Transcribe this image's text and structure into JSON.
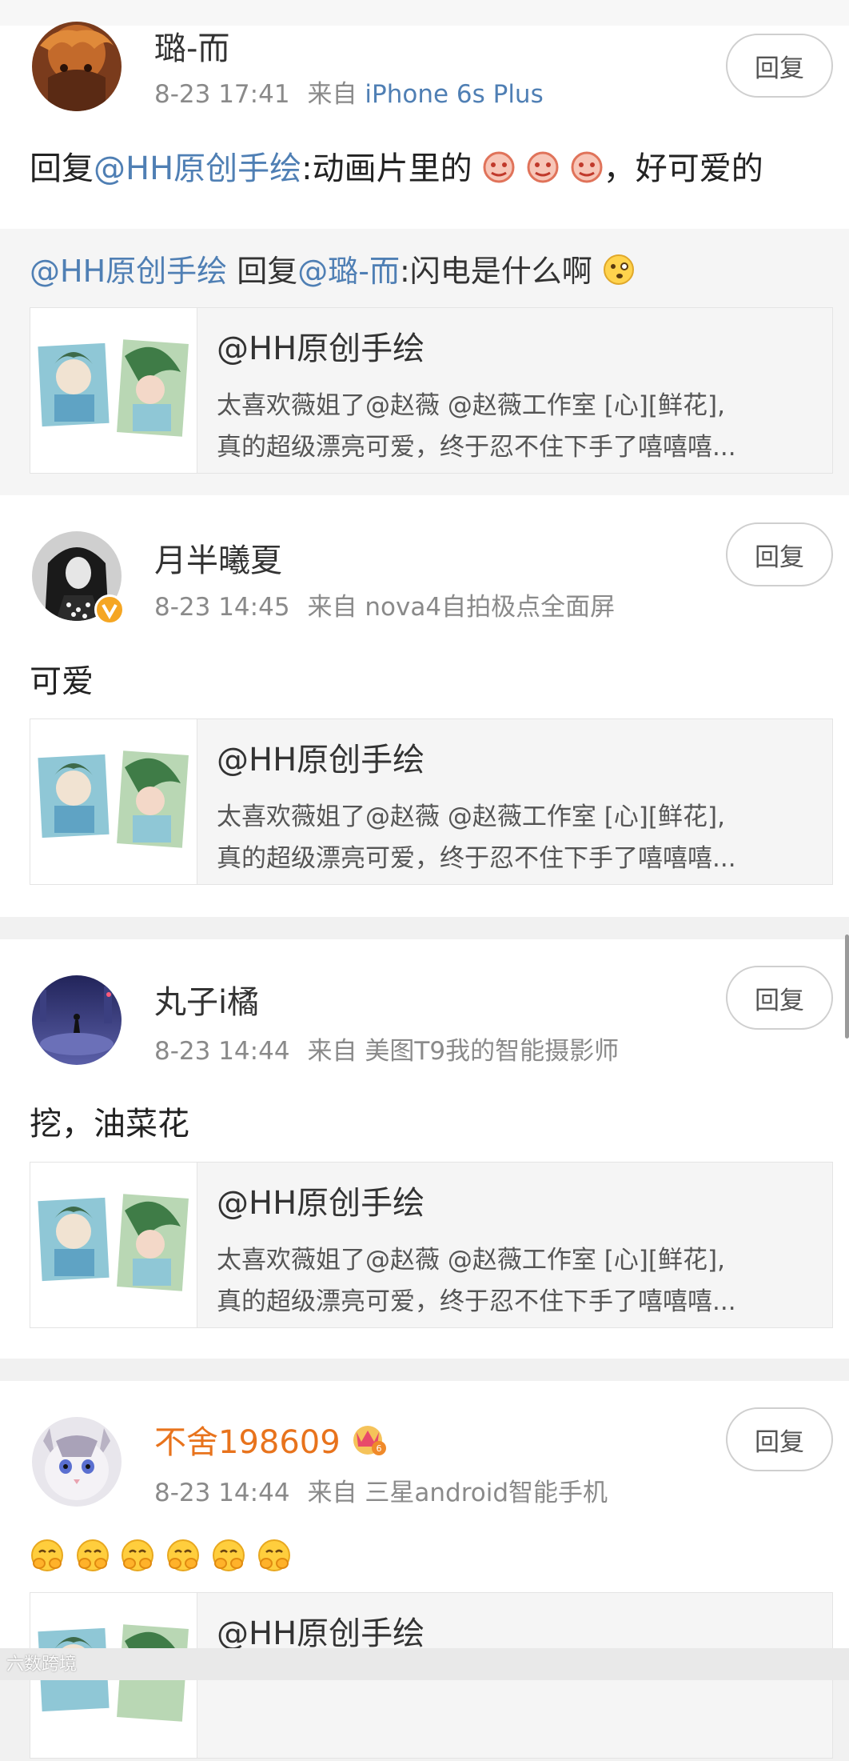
{
  "comments": [
    {
      "username": "璐-而",
      "timestamp": "8-23 17:41",
      "source_prefix": "来自",
      "device": "iPhone 6s Plus",
      "reply_label": "回复",
      "content": {
        "prefix": "回复",
        "mention": "@HH原创手绘",
        "text": ":动画片里的",
        "suffix": "，好可爱的"
      },
      "sub_reply": {
        "author": "@HH原创手绘",
        "reply_word": "回复",
        "target": "@璐-而",
        "text": ":闪电是什么啊"
      },
      "quote": {
        "title": "@HH原创手绘",
        "line1": "太喜欢薇姐了@赵薇 @赵薇工作室 [心][鲜花],",
        "line2": "真的超级漂亮可爱，终于忍不住下手了嘻嘻嘻..."
      }
    },
    {
      "username": "月半曦夏",
      "timestamp": "8-23 14:45",
      "source_prefix": "来自",
      "device": "nova4自拍极点全面屏",
      "reply_label": "回复",
      "content": {
        "text": "可爱"
      },
      "quote": {
        "title": "@HH原创手绘",
        "line1": "太喜欢薇姐了@赵薇 @赵薇工作室 [心][鲜花],",
        "line2": "真的超级漂亮可爱，终于忍不住下手了嘻嘻嘻..."
      }
    },
    {
      "username": "丸子i橘",
      "timestamp": "8-23 14:44",
      "source_prefix": "来自",
      "device": "美图T9我的智能摄影师",
      "reply_label": "回复",
      "content": {
        "text": "挖，油菜花"
      },
      "quote": {
        "title": "@HH原创手绘",
        "line1": "太喜欢薇姐了@赵薇 @赵薇工作室 [心][鲜花],",
        "line2": "真的超级漂亮可爱，终于忍不住下手了嘻嘻嘻..."
      }
    },
    {
      "username": "不舍198609",
      "timestamp": "8-23 14:44",
      "source_prefix": "来自",
      "device": "三星android智能手机",
      "reply_label": "回复",
      "quote": {
        "title": "@HH原创手绘"
      }
    }
  ],
  "watermark": "六数跨境",
  "colors": {
    "link": "#4f7fb4",
    "vip_name": "#e8731c",
    "meta": "#8a8a8a",
    "verified": "#f5a623"
  }
}
